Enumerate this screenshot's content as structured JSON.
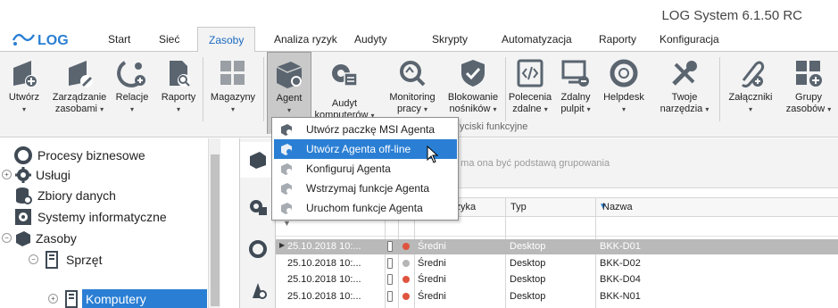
{
  "app": {
    "title": "LOG System 6.1.50 RC",
    "logo_text": "LOG"
  },
  "tabs": [
    "Start",
    "Sieć",
    "Zasoby",
    "Analiza ryzyk",
    "Audyty",
    "Skrypty",
    "Automatyzacja",
    "Raporty",
    "Konfiguracja"
  ],
  "active_tab": "Zasoby",
  "ribbon": {
    "buttons": [
      {
        "label": "Utwórz",
        "dropdown": true,
        "icon": "create-icon"
      },
      {
        "label": "Zarządzanie zasobami",
        "line1": "Zarządzanie",
        "line2": "zasobami",
        "dropdown": true,
        "icon": "manage-assets-icon"
      },
      {
        "label": "Relacje",
        "dropdown": true,
        "icon": "relations-icon"
      },
      {
        "label": "Raporty",
        "dropdown": true,
        "icon": "reports-icon"
      },
      {
        "label": "Magazyny",
        "dropdown": true,
        "icon": "warehouses-icon"
      },
      {
        "label": "Agent",
        "dropdown": true,
        "icon": "agent-icon"
      },
      {
        "label": "Audyt komputerów",
        "line1": "Audyt",
        "line2": "komputerów",
        "dropdown": true,
        "icon": "computer-audit-icon"
      },
      {
        "label": "Monitoring pracy",
        "line1": "Monitoring",
        "line2": "pracy",
        "dropdown": true,
        "icon": "work-monitoring-icon"
      },
      {
        "label": "Blokowanie nośników",
        "line1": "Blokowanie",
        "line2": "nośników",
        "dropdown": true,
        "icon": "media-blocking-icon"
      },
      {
        "label": "Polecenia zdalne",
        "line1": "Polecenia",
        "line2": "zdalne",
        "dropdown": true,
        "icon": "remote-commands-icon"
      },
      {
        "label": "Zdalny pulpit",
        "line1": "Zdalny",
        "line2": "pulpit",
        "dropdown": true,
        "icon": "remote-desktop-icon"
      },
      {
        "label": "Helpdesk",
        "dropdown": true,
        "icon": "helpdesk-icon"
      },
      {
        "label": "Twoje narzędzia",
        "line1": "Twoje",
        "line2": "narzędzia",
        "dropdown": true,
        "icon": "tools-icon"
      },
      {
        "label": "Załączniki",
        "dropdown": true,
        "icon": "attachments-icon"
      },
      {
        "label": "Grupy zasobów",
        "line1": "Grupy",
        "line2": "zasobów",
        "dropdown": true,
        "icon": "asset-groups-icon"
      }
    ],
    "group_label_partial": "yciski funkcyjne"
  },
  "agent_menu": {
    "items": [
      {
        "label": "Utwórz paczkę MSI Agenta",
        "enabled": true
      },
      {
        "label": "Utwórz Agenta off-line",
        "enabled": true,
        "highlighted": true
      },
      {
        "label": "Konfiguruj Agenta",
        "enabled": true
      },
      {
        "label": "Wstrzymaj funkcje Agenta",
        "enabled": true
      },
      {
        "label": "Uruchom funkcje Agenta",
        "enabled": true
      }
    ]
  },
  "tree": {
    "items": [
      {
        "label": "Procesy biznesowe",
        "icon": "business-process-icon"
      },
      {
        "label": "Usługi",
        "icon": "services-icon"
      },
      {
        "label": "Zbiory danych",
        "icon": "datasets-icon"
      },
      {
        "label": "Systemy informatyczne",
        "icon": "it-systems-icon"
      },
      {
        "label": "Zasoby",
        "icon": "assets-icon"
      },
      {
        "label": "Sprzęt",
        "icon": "hardware-icon"
      },
      {
        "label": "Komputery",
        "icon": "computers-icon",
        "selected": true
      }
    ]
  },
  "grid": {
    "group_hint": "a ma ona być podstawą grupowania",
    "columns": [
      "yzyka",
      "Typ",
      "Nazwa"
    ],
    "rows": [
      {
        "date": "25.10.2018 10:...",
        "status_color": "#e0533e",
        "risk": "Średni",
        "type": "Desktop",
        "name": "BKK-D01",
        "selected": true
      },
      {
        "date": "25.10.2018 10:...",
        "status_color": "#b5b5b5",
        "risk": "Średni",
        "type": "Desktop",
        "name": "BKK-D02"
      },
      {
        "date": "25.10.2018 10:...",
        "status_color": "#e0533e",
        "risk": "Średni",
        "type": "Desktop",
        "name": "BKK-D04"
      },
      {
        "date": "25.10.2018 10:...",
        "status_color": "#e0533e",
        "risk": "Średni",
        "type": "Desktop",
        "name": "BKK-N01"
      }
    ]
  },
  "colors": {
    "accent": "#2a7fd4",
    "tab_active_text": "#1d6bc1",
    "icon_dark": "#5a6570"
  }
}
